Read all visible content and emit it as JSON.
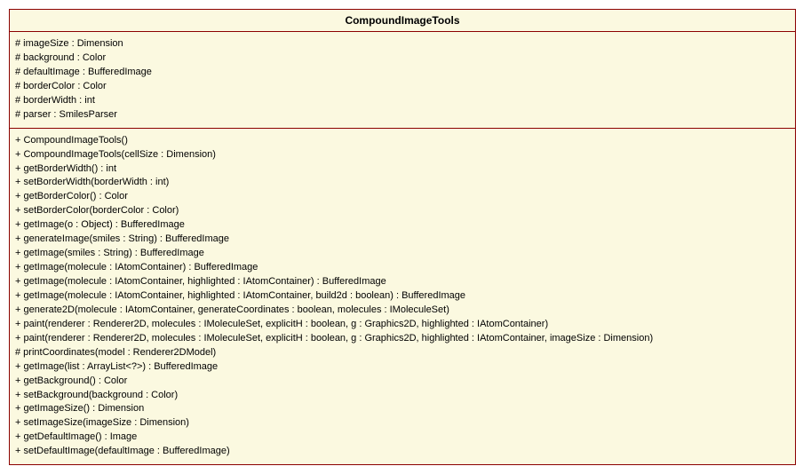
{
  "class": {
    "name": "CompoundImageTools",
    "attributes": [
      "# imageSize : Dimension",
      "# background : Color",
      "# defaultImage : BufferedImage",
      "# borderColor : Color",
      "# borderWidth : int",
      "# parser : SmilesParser"
    ],
    "methods": [
      "+ CompoundImageTools()",
      "+ CompoundImageTools(cellSize : Dimension)",
      "+ getBorderWidth() : int",
      "+ setBorderWidth(borderWidth : int)",
      "+ getBorderColor() : Color",
      "+ setBorderColor(borderColor : Color)",
      "+ getImage(o : Object) : BufferedImage",
      "+ generateImage(smiles : String) : BufferedImage",
      "+ getImage(smiles : String) : BufferedImage",
      "+ getImage(molecule : IAtomContainer) : BufferedImage",
      "+ getImage(molecule : IAtomContainer, highlighted : IAtomContainer) : BufferedImage",
      "+ getImage(molecule : IAtomContainer, highlighted : IAtomContainer, build2d : boolean) : BufferedImage",
      "+ generate2D(molecule : IAtomContainer, generateCoordinates : boolean, molecules : IMoleculeSet)",
      "+ paint(renderer : Renderer2D, molecules : IMoleculeSet, explicitH : boolean, g : Graphics2D, highlighted : IAtomContainer)",
      "+ paint(renderer : Renderer2D, molecules : IMoleculeSet, explicitH : boolean, g : Graphics2D, highlighted : IAtomContainer, imageSize : Dimension)",
      "# printCoordinates(model : Renderer2DModel)",
      "+ getImage(list : ArrayList<?>) : BufferedImage",
      "+ getBackground() : Color",
      "+ setBackground(background : Color)",
      "+ getImageSize() : Dimension",
      "+ setImageSize(imageSize : Dimension)",
      "+ getDefaultImage() : Image",
      "+ setDefaultImage(defaultImage : BufferedImage)"
    ]
  }
}
